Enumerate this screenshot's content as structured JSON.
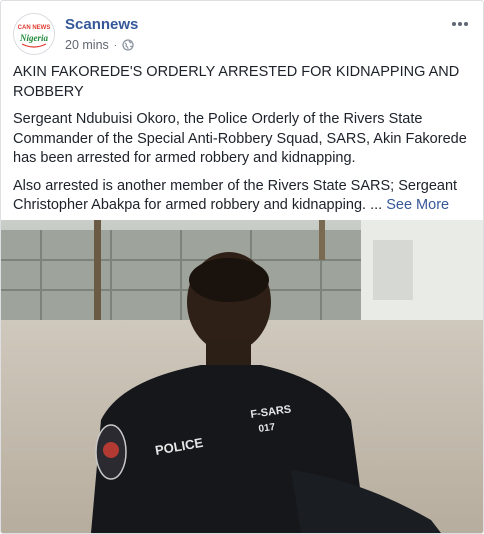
{
  "post": {
    "author": "Scannews",
    "time": "20 mins",
    "dot": "·",
    "headline": "AKIN FAKOREDE'S ORDERLY ARRESTED FOR KIDNAPPING AND ROBBERY",
    "paragraph1": "Sergeant Ndubuisi Okoro, the Police Orderly of the Rivers State Commander of the Special Anti-Robbery Squad, SARS, Akin Fakorede has been arrested for armed robbery and kidnapping.",
    "paragraph2": "Also arrested is another member of the Rivers State SARS; Sergeant Christopher Abakpa for armed robbery and kidnapping.",
    "ellipsis": "...",
    "see_more": "See More"
  },
  "logo": {
    "top": "CAN NEWS",
    "bottom": "Nigeria"
  },
  "photo": {
    "shirt_left": "POLICE",
    "shirt_right": "F-SARS",
    "shirt_num": "017"
  },
  "icons": {
    "privacy": "globe-icon",
    "menu": "more-options-icon"
  },
  "colors": {
    "link": "#365899",
    "meta": "#616770",
    "text": "#1d2129"
  }
}
